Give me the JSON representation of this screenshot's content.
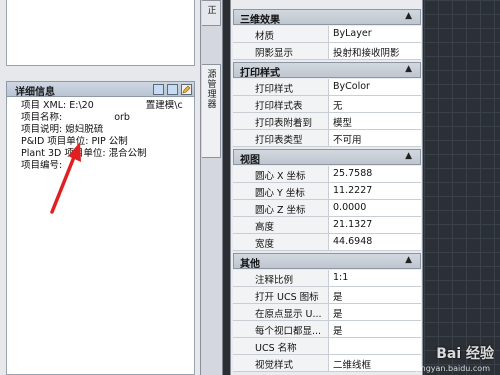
{
  "details": {
    "title": "详细信息",
    "lines": [
      {
        "label": "项目 XML:",
        "value": "E:\\20",
        "suffix": "置建模\\c"
      },
      {
        "label": "项目名称:",
        "value": "",
        "suffix": "orb"
      },
      {
        "label": "项目说明:",
        "value": "媳妇脱硫"
      },
      {
        "label": "P&ID 项目单位:",
        "value": "PIP 公制"
      },
      {
        "label": "Plant 3D 项目单位:",
        "value": "混合公制"
      },
      {
        "label": "项目编号:",
        "value": ""
      }
    ]
  },
  "tabs": {
    "tab1": "正",
    "tab2": "源管理器"
  },
  "properties": {
    "sections": [
      {
        "title": "三维效果",
        "rows": [
          {
            "k": "材质",
            "v": "ByLayer"
          },
          {
            "k": "阴影显示",
            "v": "投射和接收阴影"
          }
        ]
      },
      {
        "title": "打印样式",
        "rows": [
          {
            "k": "打印样式",
            "v": "ByColor"
          },
          {
            "k": "打印样式表",
            "v": "无"
          },
          {
            "k": "打印表附着到",
            "v": "模型"
          },
          {
            "k": "打印表类型",
            "v": "不可用"
          }
        ]
      },
      {
        "title": "视图",
        "rows": [
          {
            "k": "圆心 X 坐标",
            "v": "25.7588"
          },
          {
            "k": "圆心 Y 坐标",
            "v": "11.2227"
          },
          {
            "k": "圆心 Z 坐标",
            "v": "0.0000"
          },
          {
            "k": "高度",
            "v": "21.1327"
          },
          {
            "k": "宽度",
            "v": "44.6948"
          }
        ]
      },
      {
        "title": "其他",
        "rows": [
          {
            "k": "注释比例",
            "v": "1:1"
          },
          {
            "k": "打开 UCS 图标",
            "v": "是"
          },
          {
            "k": "在原点显示 U...",
            "v": "是"
          },
          {
            "k": "每个视口都显...",
            "v": "是"
          },
          {
            "k": "UCS 名称",
            "v": ""
          },
          {
            "k": "视觉样式",
            "v": "二维线框"
          }
        ]
      }
    ],
    "collapse_glyph": "▲"
  },
  "watermark": {
    "main": "Bai 经验",
    "sub": "jingyan.baidu.com"
  },
  "colors": {
    "arrow": "#e02020",
    "viewport": "#2b3036"
  }
}
